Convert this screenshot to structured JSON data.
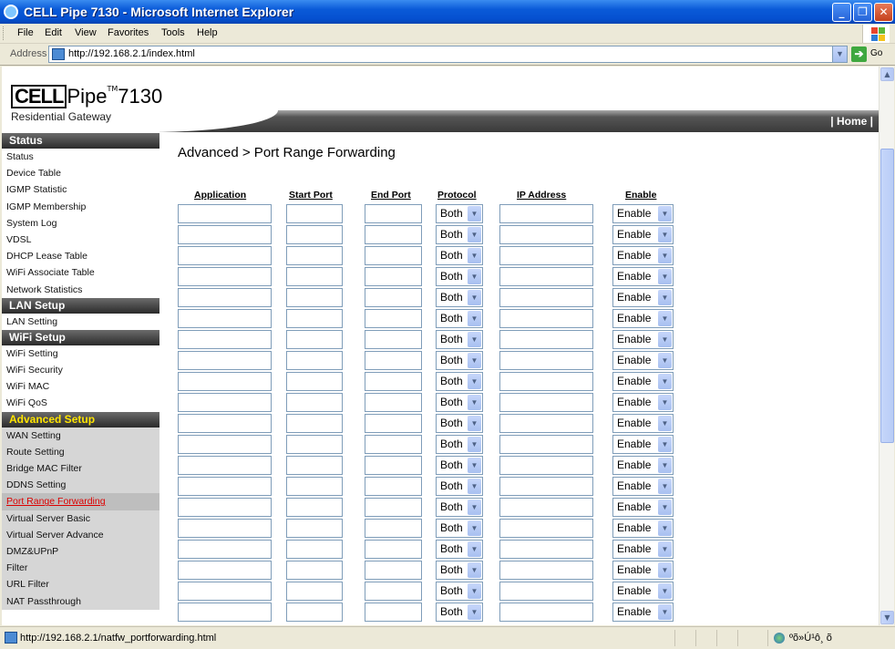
{
  "window": {
    "title": "CELL Pipe 7130 - Microsoft Internet Explorer"
  },
  "menu": [
    "File",
    "Edit",
    "View",
    "Favorites",
    "Tools",
    "Help"
  ],
  "address": {
    "label": "Address",
    "url": "http://192.168.2.1/index.html",
    "go_label": "Go"
  },
  "logo": {
    "brand_boxed": "CELL",
    "brand_rest": "Pipe",
    "tm": "TM",
    "model": "7130",
    "subtitle": "Residential Gateway"
  },
  "header": {
    "home_link": "| Home |"
  },
  "sidebar": {
    "status_header": "Status",
    "status_items": [
      "Status",
      "Device Table",
      "IGMP Statistic",
      "IGMP Membership",
      "System Log",
      "VDSL",
      "DHCP Lease Table",
      "WiFi Associate Table",
      "Network Statistics"
    ],
    "lan_header": "LAN Setup",
    "lan_items": [
      "LAN Setting"
    ],
    "wifi_header": "WiFi Setup",
    "wifi_items": [
      "WiFi Setting",
      "WiFi Security",
      "WiFi MAC",
      "WiFi QoS"
    ],
    "adv_header": "Advanced Setup",
    "adv_items": [
      "WAN Setting",
      "Route Setting",
      "Bridge MAC Filter",
      "DDNS Setting",
      "Port Range Forwarding",
      "Virtual Server Basic",
      "Virtual Server Advance",
      "DMZ&UPnP",
      "Filter",
      "URL Filter",
      "NAT Passthrough"
    ],
    "active_item": "Port Range Forwarding"
  },
  "main": {
    "heading": "Advanced > Port Range Forwarding",
    "columns": [
      "Application",
      "Start Port",
      "End Port",
      "Protocol",
      "IP Address",
      "Enable"
    ],
    "row_count": 20,
    "protocol_value": "Both",
    "enable_value": "Enable"
  },
  "status_bar": {
    "url": "http://192.168.2.1/natfw_portforwarding.html",
    "zone": "ºõ»Ú¹ô¸ õ"
  }
}
